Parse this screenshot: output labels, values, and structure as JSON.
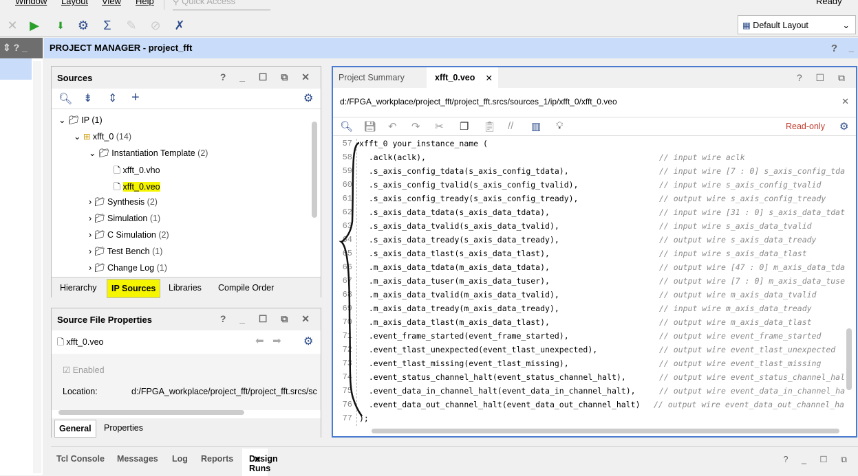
{
  "menu": [
    "Window",
    "Layout",
    "View",
    "Help"
  ],
  "quick_access_placeholder": "Quick Access",
  "status": "Ready",
  "layout_select": "Default Layout",
  "project_manager_title": "PROJECT MANAGER - project_fft",
  "sources": {
    "title": "Sources",
    "tree": [
      {
        "label": "IP",
        "count": "(1)"
      },
      {
        "label": "xfft_0",
        "count": "(14)"
      },
      {
        "label": "Instantiation Template",
        "count": "(2)"
      },
      {
        "label": "xfft_0.vho",
        "count": ""
      },
      {
        "label": "xfft_0.veo",
        "count": ""
      },
      {
        "label": "Synthesis",
        "count": "(2)"
      },
      {
        "label": "Simulation",
        "count": "(1)"
      },
      {
        "label": "C Simulation",
        "count": "(2)"
      },
      {
        "label": "Test Bench",
        "count": "(1)"
      },
      {
        "label": "Change Log",
        "count": "(1)"
      }
    ],
    "tabs": [
      "Hierarchy",
      "IP Sources",
      "Libraries",
      "Compile Order"
    ]
  },
  "properties": {
    "title": "Source File Properties",
    "file": "xfft_0.veo",
    "enabled_label": "Enabled",
    "location_label": "Location:",
    "location_value": "d:/FPGA_workplace/project_fft/project_fft.srcs/sc",
    "tabs": [
      "General",
      "Properties"
    ]
  },
  "editor": {
    "tabs": [
      "Project Summary",
      "xfft_0.veo"
    ],
    "path": "d:/FPGA_workplace/project_fft/project_fft.srcs/sources_1/ip/xfft_0/xfft_0.veo",
    "readonly": "Read-only",
    "lines": [
      {
        "n": "57",
        "code": "xfft_0 your_instance_name (",
        "comment": ""
      },
      {
        "n": "58",
        "code": "  .aclk(aclk),",
        "comment": "// input wire aclk"
      },
      {
        "n": "59",
        "code": "  .s_axis_config_tdata(s_axis_config_tdata),",
        "comment": "// input wire [7 : 0] s_axis_config_tda"
      },
      {
        "n": "60",
        "code": "  .s_axis_config_tvalid(s_axis_config_tvalid),",
        "comment": "// input wire s_axis_config_tvalid"
      },
      {
        "n": "61",
        "code": "  .s_axis_config_tready(s_axis_config_tready),",
        "comment": "// output wire s_axis_config_tready"
      },
      {
        "n": "62",
        "code": "  .s_axis_data_tdata(s_axis_data_tdata),",
        "comment": "// input wire [31 : 0] s_axis_data_tdat"
      },
      {
        "n": "63",
        "code": "  .s_axis_data_tvalid(s_axis_data_tvalid),",
        "comment": "// input wire s_axis_data_tvalid"
      },
      {
        "n": "64",
        "code": "  .s_axis_data_tready(s_axis_data_tready),",
        "comment": "// output wire s_axis_data_tready"
      },
      {
        "n": "65",
        "code": "  .s_axis_data_tlast(s_axis_data_tlast),",
        "comment": "// input wire s_axis_data_tlast"
      },
      {
        "n": "66",
        "code": "  .m_axis_data_tdata(m_axis_data_tdata),",
        "comment": "// output wire [47 : 0] m_axis_data_tda"
      },
      {
        "n": "67",
        "code": "  .m_axis_data_tuser(m_axis_data_tuser),",
        "comment": "// output wire [7 : 0] m_axis_data_tuse"
      },
      {
        "n": "68",
        "code": "  .m_axis_data_tvalid(m_axis_data_tvalid),",
        "comment": "// output wire m_axis_data_tvalid"
      },
      {
        "n": "69",
        "code": "  .m_axis_data_tready(m_axis_data_tready),",
        "comment": "// input wire m_axis_data_tready"
      },
      {
        "n": "70",
        "code": "  .m_axis_data_tlast(m_axis_data_tlast),",
        "comment": "// output wire m_axis_data_tlast"
      },
      {
        "n": "71",
        "code": "  .event_frame_started(event_frame_started),",
        "comment": "// output wire event_frame_started"
      },
      {
        "n": "72",
        "code": "  .event_tlast_unexpected(event_tlast_unexpected),",
        "comment": "// output wire event_tlast_unexpected"
      },
      {
        "n": "73",
        "code": "  .event_tlast_missing(event_tlast_missing),",
        "comment": "// output wire event_tlast_missing"
      },
      {
        "n": "74",
        "code": "  .event_status_channel_halt(event_status_channel_halt),",
        "comment": "// output wire event_status_channel_hal"
      },
      {
        "n": "75",
        "code": "  .event_data_in_channel_halt(event_data_in_channel_halt),",
        "comment": "// output wire event_data_in_channel_ha"
      },
      {
        "n": "76",
        "code": "  .event_data_out_channel_halt(event_data_out_channel_halt)",
        "comment": "// output wire event_data_out_channel_ha"
      },
      {
        "n": "77",
        "code": ");",
        "comment": ""
      }
    ]
  },
  "bottom_tabs": [
    "Tcl Console",
    "Messages",
    "Log",
    "Reports",
    "Design Runs"
  ]
}
